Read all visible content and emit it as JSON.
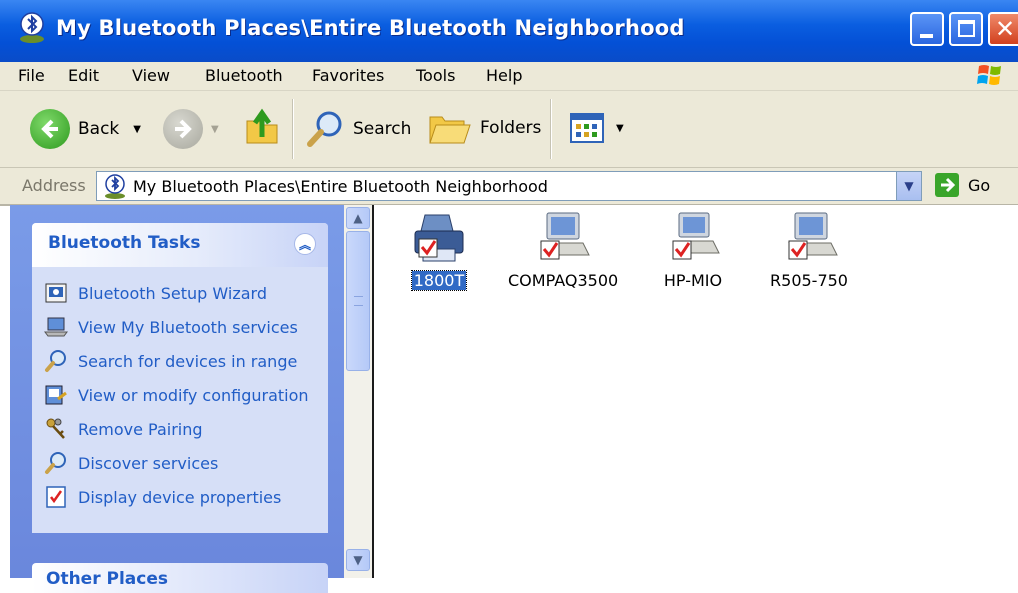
{
  "window": {
    "title": "My Bluetooth Places\\Entire Bluetooth Neighborhood"
  },
  "menu": [
    {
      "label": "File"
    },
    {
      "label": "Edit"
    },
    {
      "label": "View"
    },
    {
      "label": "Bluetooth"
    },
    {
      "label": "Favorites"
    },
    {
      "label": "Tools"
    },
    {
      "label": "Help"
    }
  ],
  "toolbar": {
    "back_label": "Back",
    "search_label": "Search",
    "folders_label": "Folders"
  },
  "address": {
    "label": "Address",
    "value": "My Bluetooth Places\\Entire Bluetooth Neighborhood",
    "go_label": "Go"
  },
  "tasks": {
    "title": "Bluetooth Tasks",
    "items": [
      {
        "label": "Bluetooth Setup Wizard",
        "icon": "wizard-icon"
      },
      {
        "label": "View My Bluetooth services",
        "icon": "laptop-icon"
      },
      {
        "label": "Search for devices in range",
        "icon": "search-icon"
      },
      {
        "label": "View or modify configuration",
        "icon": "config-icon"
      },
      {
        "label": "Remove Pairing",
        "icon": "keys-icon"
      },
      {
        "label": "Discover services",
        "icon": "search-icon"
      },
      {
        "label": "Display device properties",
        "icon": "properties-icon"
      }
    ]
  },
  "other": {
    "title": "Other Places"
  },
  "devices": [
    {
      "label": "1800T",
      "icon": "printer-icon",
      "selected": true
    },
    {
      "label": "COMPAQ3500",
      "icon": "computer-icon",
      "selected": false
    },
    {
      "label": "HP-MIO",
      "icon": "computer-icon",
      "selected": false
    },
    {
      "label": "R505-750",
      "icon": "computer-icon",
      "selected": false
    }
  ],
  "colors": {
    "titlebar": "#0a5ee0",
    "task_link": "#215dc6",
    "panel_bg": "#6a87dc",
    "selection": "#316ac5"
  }
}
